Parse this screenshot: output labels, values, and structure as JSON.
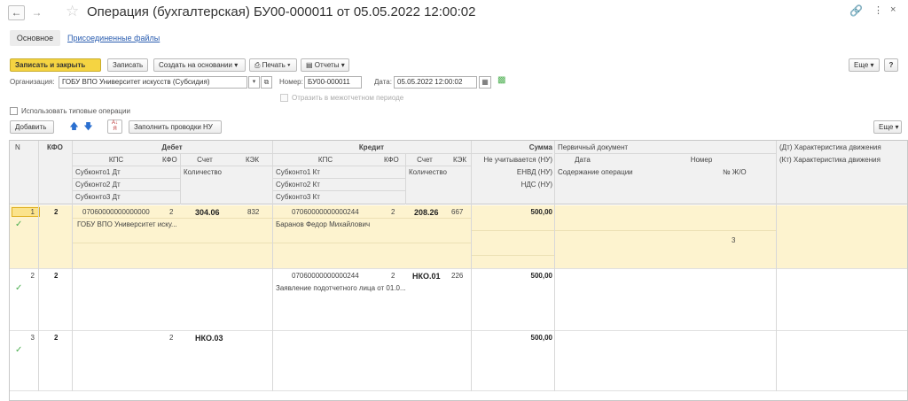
{
  "window": {
    "title": "Операция (бухгалтерская) БУ00-000011 от 05.05.2022 12:00:02"
  },
  "tabs": [
    {
      "label": "Основное"
    },
    {
      "label": "Присоединенные файлы"
    }
  ],
  "toolbar": {
    "save_close": "Записать и закрыть",
    "save": "Записать",
    "create_based": "Создать на основании",
    "print": "Печать",
    "reports": "Отчеты",
    "more": "Еще",
    "help": "?"
  },
  "form": {
    "org_label": "Организация:",
    "org_value": "ГОБУ ВПО Университет искусств (Субсидия)",
    "number_label": "Номер:",
    "number_value": "БУ00-000011",
    "date_label": "Дата:",
    "date_value": "05.05.2022 12:00:02",
    "interdept_label": "Отразить в межотчетном периоде",
    "typical_label": "Использовать типовые операции"
  },
  "table_toolbar": {
    "add": "Добавить",
    "fill": "Заполнить проводки НУ",
    "more": "Еще"
  },
  "table": {
    "headers": {
      "n": "N",
      "kfo": "КФО",
      "debit": "Дебет",
      "credit": "Кредит",
      "kps": "КПС",
      "kfo2": "КФО",
      "schet": "Счет",
      "kek": "КЭК",
      "sub1dt": "Субконто1 Дт",
      "kol": "Количество",
      "sub2dt": "Субконто2 Дт",
      "sub3dt": "Субконто3 Дт",
      "sub1kt": "Субконто1 Кт",
      "sub2kt": "Субконто2 Кт",
      "sub3kt": "Субконто3 Кт",
      "sum": "Сумма",
      "sum_nu": "Не учитывается (НУ)",
      "envd": "ЕНВД (НУ)",
      "nds": "НДС (НУ)",
      "primdoc": "Первичный документ",
      "date": "Дата",
      "nomer": "Номер",
      "content": "Содержание операции",
      "journal": "№ Ж/О",
      "dt_move": "(Дт) Характеристика движения",
      "kt_move": "(Кт) Характеристика движения"
    },
    "rows": [
      {
        "n": "1",
        "kfo": "2",
        "d_kps": "07060000000000000",
        "d_kfo": "2",
        "d_schet": "304.06",
        "d_kek": "832",
        "d_sub1": "ГОБУ ВПО Университет иску...",
        "c_kps": "07060000000000244",
        "c_kfo": "2",
        "c_schet": "208.26",
        "c_kek": "667",
        "c_sub1": "Баранов Федор Михайлович",
        "sum": "500,00",
        "journal": "3"
      },
      {
        "n": "2",
        "kfo": "2",
        "c_kps": "07060000000000244",
        "c_kfo": "2",
        "c_schet": "НКО.01",
        "c_kek": "226",
        "c_sub1": "Заявление подотчетного лица от 01.0...",
        "sum": "500,00"
      },
      {
        "n": "3",
        "kfo": "2",
        "d_kfo": "2",
        "d_schet": "НКО.03",
        "sum": "500,00"
      }
    ]
  },
  "colors": {
    "accent": "#f5d442",
    "selected_row": "#fdf3cf",
    "check": "#4caf50",
    "link": "#2a5db0"
  }
}
